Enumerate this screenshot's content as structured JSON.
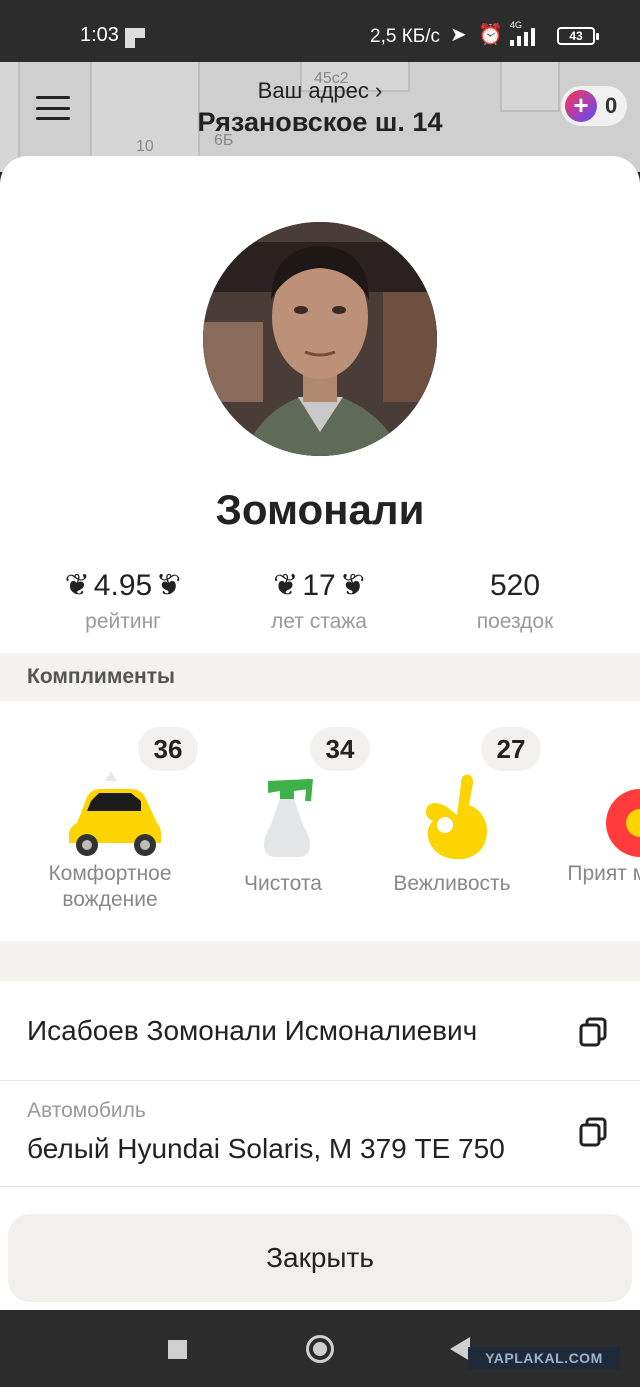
{
  "status_bar": {
    "time": "1:03",
    "net_speed": "2,5 КБ/с",
    "network_type": "4G",
    "battery": "43",
    "icons": [
      "location-arrow-icon",
      "alarm-icon",
      "signal-icon",
      "battery-icon"
    ]
  },
  "map": {
    "labels": [
      "45с2",
      "6Б",
      "10"
    ]
  },
  "header": {
    "address_hint": "Ваш адрес ›",
    "address": "Рязановское ш. 14",
    "plus_count": "0"
  },
  "driver": {
    "name": "Зомонали",
    "stats": [
      {
        "value": "4.95",
        "label": "рейтинг",
        "laurel": true
      },
      {
        "value": "17",
        "label": "лет стажа",
        "laurel": true
      },
      {
        "value": "520",
        "label": "поездок",
        "laurel": false
      }
    ]
  },
  "compliments": {
    "title": "Комплименты",
    "items": [
      {
        "count": "36",
        "label": "Комфортное вождение",
        "icon": "taxi-car-icon"
      },
      {
        "count": "34",
        "label": "Чистота",
        "icon": "spray-bottle-icon"
      },
      {
        "count": "27",
        "label": "Вежливость",
        "icon": "ok-hand-icon"
      },
      {
        "count": "",
        "label": "Прият музы",
        "icon": "music-icon"
      }
    ]
  },
  "info": {
    "full_name": "Исабоев Зомонали Исмоналиевич",
    "car_label": "Автомобиль",
    "car_value": "белый Hyundai Solaris, М 379 ТЕ 750"
  },
  "actions": {
    "close_label": "Закрыть"
  },
  "watermark": "YAPLAKAL.COM",
  "colors": {
    "accent_yellow": "#fcd400",
    "sheet_bg": "#ffffff",
    "muted_text": "#9a9a9a",
    "band_bg": "#f3f2ef"
  }
}
